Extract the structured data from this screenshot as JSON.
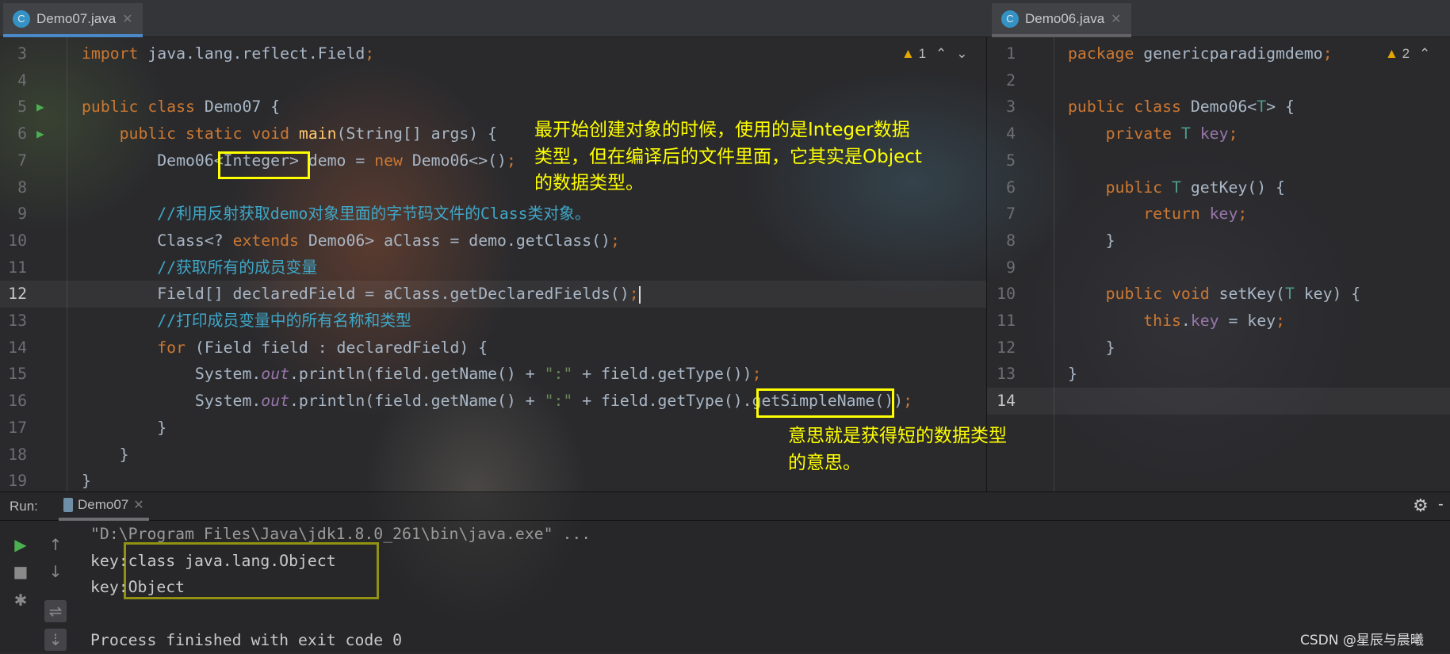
{
  "left_editor": {
    "tab": {
      "label": "Demo07.java",
      "icon": "java-class-icon"
    },
    "warnings": {
      "count": "1"
    },
    "current_line": 12,
    "lines": [
      {
        "n": "3",
        "tokens": [
          {
            "t": "import ",
            "k": "kw"
          },
          {
            "t": "java.lang.reflect.Field",
            "k": "id"
          },
          {
            "t": ";",
            "k": "kw"
          }
        ]
      },
      {
        "n": "4",
        "tokens": []
      },
      {
        "n": "5",
        "run": true,
        "tokens": [
          {
            "t": "public class ",
            "k": "kw"
          },
          {
            "t": "Demo07 {",
            "k": "id"
          }
        ]
      },
      {
        "n": "6",
        "run": true,
        "tokens": [
          {
            "t": "    public static void ",
            "k": "kw"
          },
          {
            "t": "main",
            "k": "fn"
          },
          {
            "t": "(String[] args) {",
            "k": "id"
          }
        ]
      },
      {
        "n": "7",
        "tokens": [
          {
            "t": "        Demo06<Integer> demo = ",
            "k": "id"
          },
          {
            "t": "new ",
            "k": "kw"
          },
          {
            "t": "Demo06<>()",
            "k": "id"
          },
          {
            "t": ";",
            "k": "kw"
          }
        ]
      },
      {
        "n": "8",
        "tokens": []
      },
      {
        "n": "9",
        "tokens": [
          {
            "t": "        //利用反射获取demo对象里面的字节码文件的Class类对象。",
            "k": "cm"
          }
        ]
      },
      {
        "n": "10",
        "tokens": [
          {
            "t": "        Class<? ",
            "k": "id"
          },
          {
            "t": "extends ",
            "k": "kw"
          },
          {
            "t": "Demo06> aClass = demo.getClass()",
            "k": "id"
          },
          {
            "t": ";",
            "k": "kw"
          }
        ]
      },
      {
        "n": "11",
        "tokens": [
          {
            "t": "        //获取所有的成员变量",
            "k": "cm"
          }
        ]
      },
      {
        "n": "12",
        "tokens": [
          {
            "t": "        Field[] declaredField = aClass.getDeclaredFields()",
            "k": "id"
          },
          {
            "t": ";",
            "k": "kw"
          }
        ]
      },
      {
        "n": "13",
        "tokens": [
          {
            "t": "        //打印成员变量中的所有名称和类型",
            "k": "cm"
          }
        ]
      },
      {
        "n": "14",
        "tokens": [
          {
            "t": "        for ",
            "k": "kw"
          },
          {
            "t": "(Field field : declaredField) {",
            "k": "id"
          }
        ]
      },
      {
        "n": "15",
        "tokens": [
          {
            "t": "            System.",
            "k": "id"
          },
          {
            "t": "out",
            "k": "sf"
          },
          {
            "t": ".println(field.getName() + ",
            "k": "id"
          },
          {
            "t": "\":\"",
            "k": "st"
          },
          {
            "t": " + field.getType())",
            "k": "id"
          },
          {
            "t": ";",
            "k": "kw"
          }
        ]
      },
      {
        "n": "16",
        "tokens": [
          {
            "t": "            System.",
            "k": "id"
          },
          {
            "t": "out",
            "k": "sf"
          },
          {
            "t": ".println(field.getName() + ",
            "k": "id"
          },
          {
            "t": "\":\"",
            "k": "st"
          },
          {
            "t": " + field.getType().getSimpleName())",
            "k": "id"
          },
          {
            "t": ";",
            "k": "kw"
          }
        ]
      },
      {
        "n": "17",
        "tokens": [
          {
            "t": "        }",
            "k": "id"
          }
        ]
      },
      {
        "n": "18",
        "tokens": [
          {
            "t": "    }",
            "k": "id"
          }
        ]
      },
      {
        "n": "19",
        "tokens": [
          {
            "t": "}",
            "k": "id"
          }
        ]
      }
    ]
  },
  "right_editor": {
    "tab": {
      "label": "Demo06.java",
      "icon": "java-class-icon"
    },
    "warnings": {
      "count": "2"
    },
    "current_line": 14,
    "lines": [
      {
        "n": "1",
        "tokens": [
          {
            "t": "package ",
            "k": "kw"
          },
          {
            "t": "genericparadigmdemo",
            "k": "id"
          },
          {
            "t": ";",
            "k": "kw"
          }
        ]
      },
      {
        "n": "2",
        "tokens": []
      },
      {
        "n": "3",
        "tokens": [
          {
            "t": "public class ",
            "k": "kw"
          },
          {
            "t": "Demo06<",
            "k": "id"
          },
          {
            "t": "T",
            "k": "tp"
          },
          {
            "t": "> {",
            "k": "id"
          }
        ]
      },
      {
        "n": "4",
        "tokens": [
          {
            "t": "    private ",
            "k": "kw"
          },
          {
            "t": "T ",
            "k": "tp"
          },
          {
            "t": "key",
            "k": "fld"
          },
          {
            "t": ";",
            "k": "kw"
          }
        ]
      },
      {
        "n": "5",
        "tokens": []
      },
      {
        "n": "6",
        "tokens": [
          {
            "t": "    public ",
            "k": "kw"
          },
          {
            "t": "T ",
            "k": "tp"
          },
          {
            "t": "getKey() {",
            "k": "id"
          }
        ]
      },
      {
        "n": "7",
        "tokens": [
          {
            "t": "        return ",
            "k": "kw"
          },
          {
            "t": "key",
            "k": "fld"
          },
          {
            "t": ";",
            "k": "kw"
          }
        ]
      },
      {
        "n": "8",
        "tokens": [
          {
            "t": "    }",
            "k": "id"
          }
        ]
      },
      {
        "n": "9",
        "tokens": []
      },
      {
        "n": "10",
        "tokens": [
          {
            "t": "    public void ",
            "k": "kw"
          },
          {
            "t": "setKey(",
            "k": "id"
          },
          {
            "t": "T ",
            "k": "tp"
          },
          {
            "t": "key) {",
            "k": "id"
          }
        ]
      },
      {
        "n": "11",
        "tokens": [
          {
            "t": "        this",
            "k": "kw"
          },
          {
            "t": ".",
            "k": "id"
          },
          {
            "t": "key",
            "k": "fld"
          },
          {
            "t": " = key",
            "k": "id"
          },
          {
            "t": ";",
            "k": "kw"
          }
        ]
      },
      {
        "n": "12",
        "tokens": [
          {
            "t": "    }",
            "k": "id"
          }
        ]
      },
      {
        "n": "13",
        "tokens": [
          {
            "t": "}",
            "k": "id"
          }
        ]
      },
      {
        "n": "14",
        "tokens": []
      }
    ]
  },
  "annotations": {
    "note1": "最开始创建对象的时候，使用的是Integer数据\n类型，但在编译后的文件里面，它其实是Object\n的数据类型。",
    "note2": "意思就是获得短的数据类型\n的意思。",
    "highlight_color": "#ffff00"
  },
  "run_panel": {
    "label": "Run:",
    "tab": "Demo07",
    "output": [
      "\"D:\\Program Files\\Java\\jdk1.8.0_261\\bin\\java.exe\" ...",
      "key:class java.lang.Object",
      "key:Object",
      "",
      "Process finished with exit code 0"
    ]
  },
  "watermark": "CSDN @星辰与晨曦"
}
